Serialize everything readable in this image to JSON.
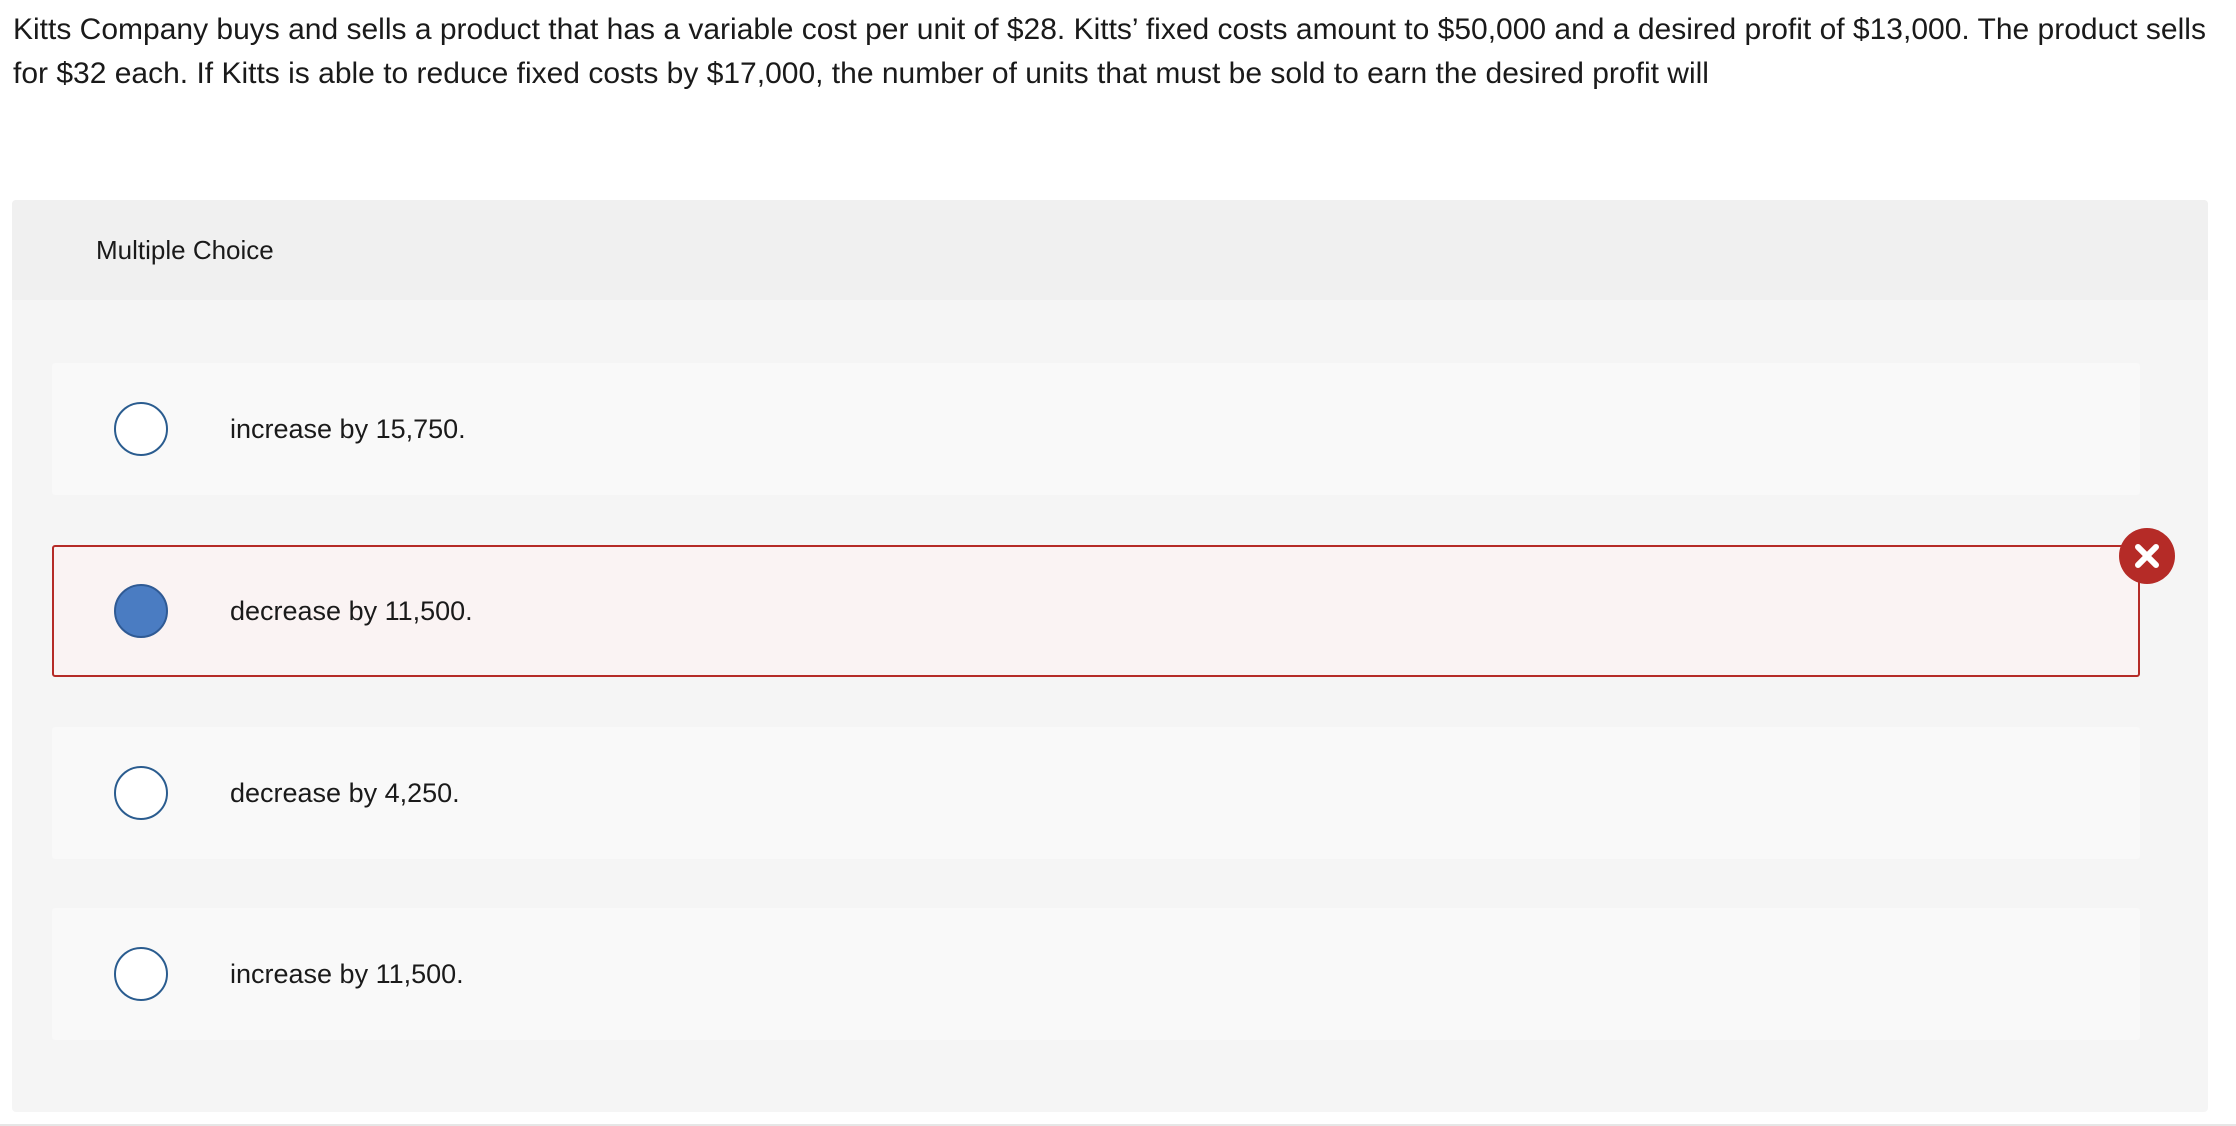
{
  "question": {
    "text": "Kitts Company buys and sells a product that has a variable cost per unit of $28. Kitts’ fixed costs amount to $50,000 and a desired profit of $13,000. The product sells for $32 each. If Kitts is able to reduce fixed costs by $17,000, the number of units that must be sold to earn the desired profit will"
  },
  "multiple_choice": {
    "header": "Multiple Choice",
    "options": [
      {
        "label": "increase by 15,750.",
        "selected": false
      },
      {
        "label": "decrease by 11,500.",
        "selected": true,
        "status": "incorrect"
      },
      {
        "label": "decrease by 4,250.",
        "selected": false
      },
      {
        "label": "increase by 11,500.",
        "selected": false
      }
    ]
  },
  "colors": {
    "incorrect": "#b52b27",
    "selected_radio": "#4a7cc2",
    "radio_border": "#2a5c8f",
    "panel_background": "#f5f5f5",
    "option_background": "#f9f9f9"
  },
  "icons": {
    "incorrect_marker": "close-x-circle-icon"
  }
}
